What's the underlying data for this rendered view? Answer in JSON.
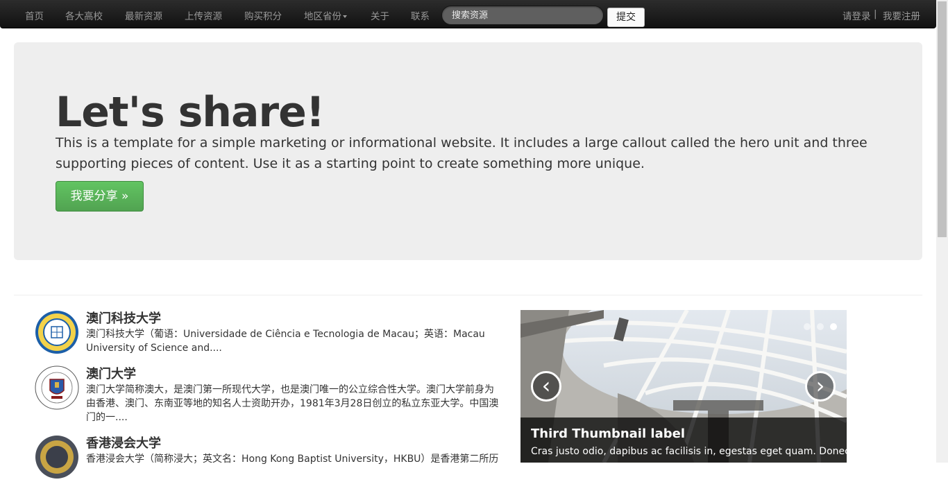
{
  "navbar": {
    "items": [
      "首页",
      "各大高校",
      "最新资源",
      "上传资源",
      "购买积分",
      "地区省份",
      "关于",
      "联系"
    ],
    "search_placeholder": "搜索资源",
    "submit_label": "提交",
    "login_label": "请登录",
    "separator": "|",
    "register_label": "我要注册"
  },
  "hero": {
    "title": "Let's share!",
    "text": "This is a template for a simple marketing or informational website. It includes a large callout called the hero unit and three supporting pieces of content. Use it as a starting point to create something more unique.",
    "button_label": "我要分享 »"
  },
  "schools": [
    {
      "name": "澳门科技大学",
      "description": "澳门科技大学（葡语：Universidade de Ciência e Tecnologia de Macau；英语：Macau University of Science and...."
    },
    {
      "name": "澳门大学",
      "description": "澳门大学简称澳大，是澳门第一所现代大学，也是澳门唯一的公立综合性大学。澳门大学前身为由香港、澳门、东南亚等地的知名人士资助开办，1981年3月28日创立的私立东亚大学。中国澳门的一...."
    },
    {
      "name": "香港浸会大学",
      "description": "香港浸会大学（简称浸大；英文名：Hong Kong Baptist University，HKBU）是香港第二所历"
    }
  ],
  "carousel": {
    "caption_title": "Third Thumbnail label",
    "caption_text": "Cras justo odio, dapibus ac facilisis in, egestas eget quam. Donec",
    "prev_symbol": "‹",
    "next_symbol": "›",
    "slide_count": 3,
    "active_slide": 3
  },
  "colors": {
    "navbar_bg": "#1b1b1b",
    "hero_bg": "#eeeeee",
    "success_button": "#5bb75b",
    "nav_text": "#999999"
  }
}
